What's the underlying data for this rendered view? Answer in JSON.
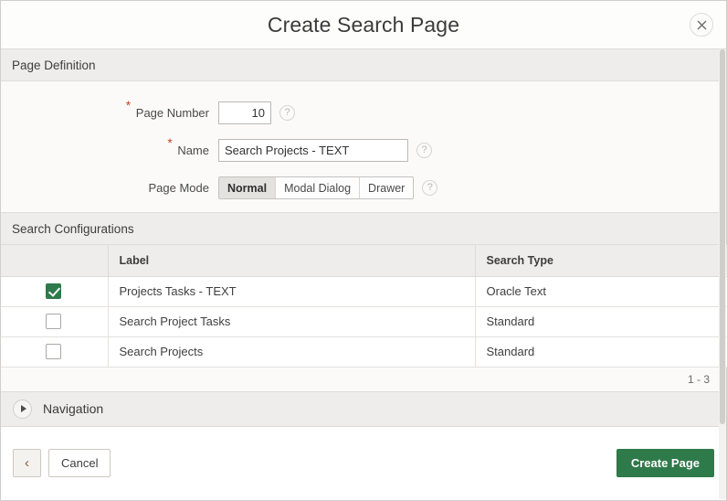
{
  "dialog": {
    "title": "Create Search Page",
    "close_icon": "close-icon"
  },
  "page_definition": {
    "region_title": "Page Definition",
    "fields": {
      "page_number": {
        "label": "Page Number",
        "value": "10",
        "required_marker": "*",
        "help_icon": "?"
      },
      "name": {
        "label": "Name",
        "value": "Search Projects - TEXT",
        "placeholder": "",
        "required_marker": "*",
        "help_icon": "?"
      },
      "page_mode": {
        "label": "Page Mode",
        "help_icon": "?",
        "selected": "Normal",
        "options": [
          "Normal",
          "Modal Dialog",
          "Drawer"
        ]
      }
    }
  },
  "search_configurations": {
    "region_title": "Search Configurations",
    "columns": [
      "",
      "Label",
      "Search Type"
    ],
    "rows": [
      {
        "checked": true,
        "label": "Projects Tasks - TEXT",
        "search_type": "Oracle Text"
      },
      {
        "checked": false,
        "label": "Search Project Tasks",
        "search_type": "Standard"
      },
      {
        "checked": false,
        "label": "Search Projects",
        "search_type": "Standard"
      }
    ],
    "pagination": "1 - 3"
  },
  "navigation": {
    "region_title": "Navigation",
    "expanded": false,
    "disclose_icon": "triangle-right-icon"
  },
  "footer": {
    "back_label": "‹",
    "cancel_label": "Cancel",
    "create_label": "Create Page"
  },
  "colors": {
    "primary_green": "#2e7a4a",
    "required_red": "#c8452c",
    "region_header_bg": "#eeedeb",
    "form_bg": "#fbfaf9"
  }
}
